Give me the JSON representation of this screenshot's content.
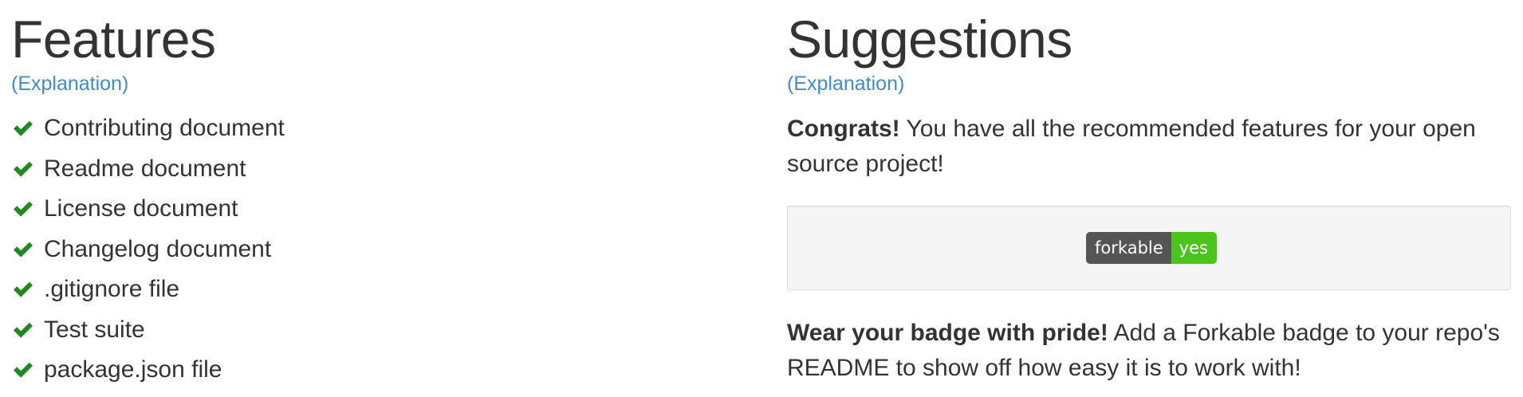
{
  "features": {
    "title": "Features",
    "explanation_link": "(Explanation)",
    "items": [
      {
        "label": "Contributing document",
        "icon": "check-icon"
      },
      {
        "label": "Readme document",
        "icon": "check-icon"
      },
      {
        "label": "License document",
        "icon": "check-icon"
      },
      {
        "label": "Changelog document",
        "icon": "check-icon"
      },
      {
        "label": ".gitignore file",
        "icon": "check-icon"
      },
      {
        "label": "Test suite",
        "icon": "check-icon"
      },
      {
        "label": "package.json file",
        "icon": "check-icon"
      }
    ]
  },
  "suggestions": {
    "title": "Suggestions",
    "explanation_link": "(Explanation)",
    "congrats_bold": "Congrats!",
    "congrats_text": " You have all the recommended features for your open source project!",
    "badge": {
      "left_label": "forkable",
      "right_label": "yes"
    },
    "wear_bold": "Wear your badge with pride!",
    "wear_text": " Add a Forkable badge to your repo's README to show off how easy it is to work with!"
  },
  "colors": {
    "check_icon": "#1e8a1e",
    "link": "#428bca",
    "badge_left": "#555555",
    "badge_right": "#4bc51d"
  }
}
